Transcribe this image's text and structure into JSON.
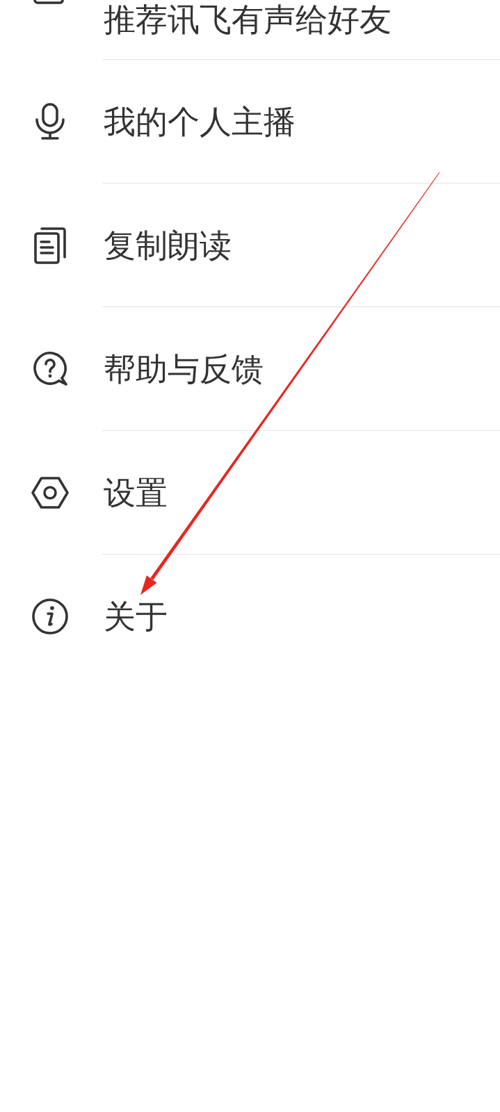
{
  "menu": {
    "items": [
      {
        "label": "推荐讯飞有声给好友"
      },
      {
        "label": "我的个人主播"
      },
      {
        "label": "复制朗读"
      },
      {
        "label": "帮助与反馈"
      },
      {
        "label": "设置"
      },
      {
        "label": "关于"
      }
    ]
  }
}
